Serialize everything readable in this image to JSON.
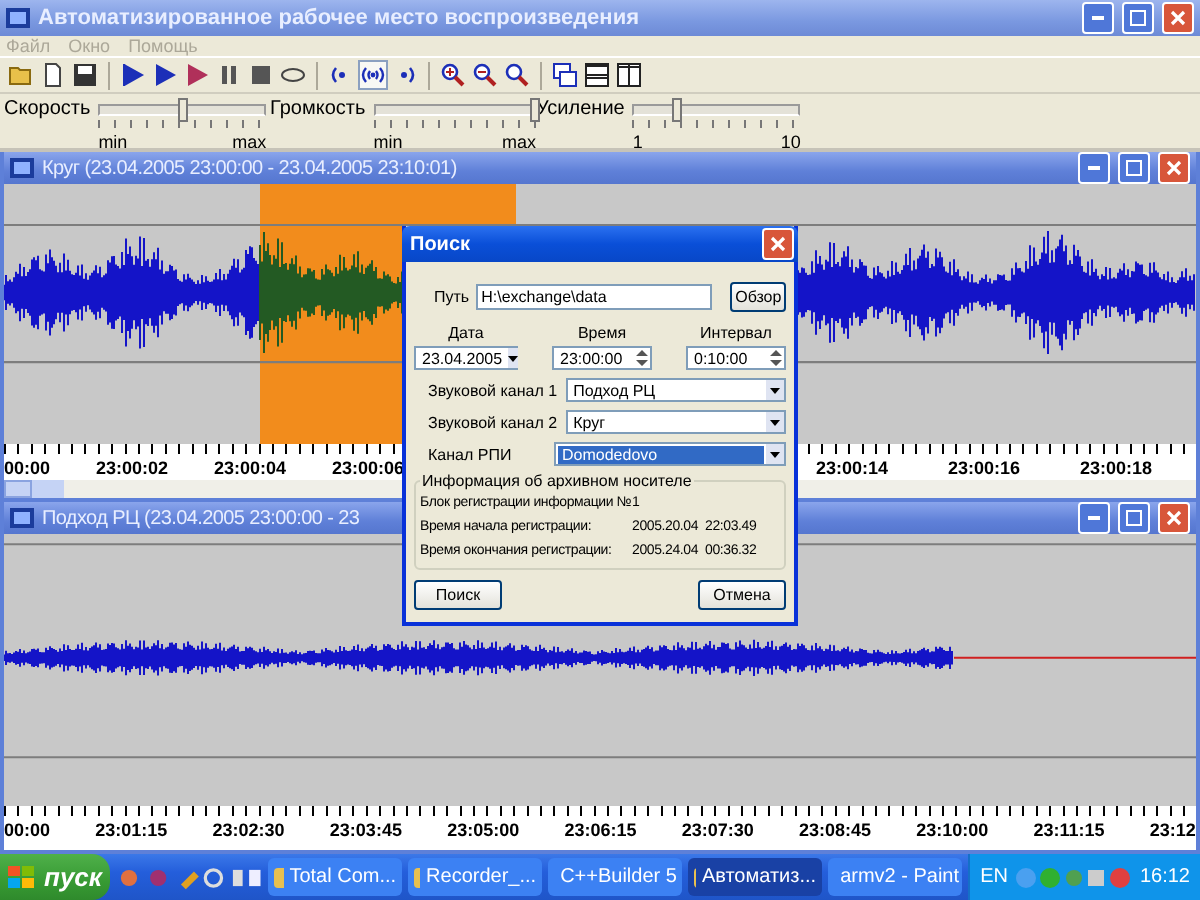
{
  "window": {
    "title": "Автоматизированное рабочее место воспроизведения"
  },
  "menu": [
    {
      "label": "Файл",
      "disabled": true
    },
    {
      "label": "Окно",
      "disabled": true
    },
    {
      "label": "Помощь",
      "disabled": true
    }
  ],
  "toolbar": [
    {
      "kind": "open",
      "pressed": false
    },
    {
      "kind": "new",
      "pressed": false
    },
    {
      "kind": "save",
      "pressed": false
    },
    {
      "kind": "separator"
    },
    {
      "kind": "mark",
      "pressed": false
    },
    {
      "kind": "play",
      "pressed": false
    },
    {
      "kind": "play-mark",
      "pressed": false
    },
    {
      "kind": "pause",
      "pressed": false
    },
    {
      "kind": "stop",
      "pressed": false
    },
    {
      "kind": "loop",
      "pressed": false
    },
    {
      "kind": "separator"
    },
    {
      "kind": "left-channel",
      "pressed": false
    },
    {
      "kind": "both-channels",
      "pressed": true
    },
    {
      "kind": "right-channel",
      "pressed": false
    },
    {
      "kind": "separator"
    },
    {
      "kind": "zoom-in",
      "pressed": false
    },
    {
      "kind": "zoom-out",
      "pressed": false
    },
    {
      "kind": "zoom-fit",
      "pressed": false
    },
    {
      "kind": "separator"
    },
    {
      "kind": "cascade",
      "pressed": false
    },
    {
      "kind": "tile-horizontal",
      "pressed": false
    },
    {
      "kind": "tile-vertical",
      "pressed": false
    }
  ],
  "sliders": [
    {
      "label": "Скорость",
      "level": 0.5,
      "min": "min",
      "max": "max"
    },
    {
      "label": "Громкость",
      "level": 1,
      "min": "min",
      "max": "max"
    },
    {
      "label": "Усиление",
      "level": 0.25,
      "min": "1",
      "max": "10"
    }
  ],
  "channels": [
    {
      "kind": "dense",
      "title": "Круг (23.04.2005 23:00:00 - 23.04.2005 23:10:01)",
      "timeline_left": [
        "00:00",
        "23:00:02",
        "23:00:04",
        "23:00:06"
      ],
      "timeline_right": [
        "23:00:14",
        "23:00:16",
        "23:00:18"
      ]
    },
    {
      "kind": "sparse",
      "title": "Подход РЦ (23.04.2005 23:00:00 - 23",
      "timeline_left": [
        "00:00",
        "23:01:15",
        "23:02:30",
        "23:03:45",
        "23:05:00",
        "23:06:15",
        "23:07:30",
        "23:08:45",
        "23:10:00",
        "23:11:15",
        "23:12"
      ]
    }
  ],
  "search_dialog": {
    "title": "Поиск",
    "path_label": "Путь",
    "path": "H:\\exchange\\data",
    "browse": "Обзор",
    "date_label": "Дата",
    "date": "23.04.2005",
    "time_label": "Время",
    "time": "23:00:00",
    "interval_label": "Интервал",
    "interval": "0:10:00",
    "fields": [
      {
        "label": "Звуковой канал 1",
        "value": "Подход РЦ",
        "focused": false
      },
      {
        "label": "Звуковой канал 2",
        "value": "Круг",
        "focused": false
      },
      {
        "label": "Канал РПИ",
        "value": "Domodedovo",
        "focused": true
      }
    ],
    "group": {
      "title": "Информация об архивном носителе",
      "rows": [
        {
          "label": "Блок регистрации информации №",
          "value": "1"
        },
        {
          "label": "Время начала регистрации:",
          "value": "2005.20.04  22:03.49"
        },
        {
          "label": "Время окончания регистрации:",
          "value": "2005.24.04  00:36.32"
        }
      ]
    },
    "buttons": [
      "Поиск",
      "Отмена"
    ]
  },
  "taskbar": {
    "start": "пуск",
    "tasks": [
      {
        "label": "Total Com...",
        "selected": false
      },
      {
        "label": "Recorder_...",
        "selected": false
      },
      {
        "label": "C++Builder 5",
        "selected": false
      },
      {
        "label": "Автоматиз...",
        "selected": true
      },
      {
        "label": "armv2 - Paint",
        "selected": false
      }
    ],
    "language": "EN",
    "clock": "16:12"
  }
}
